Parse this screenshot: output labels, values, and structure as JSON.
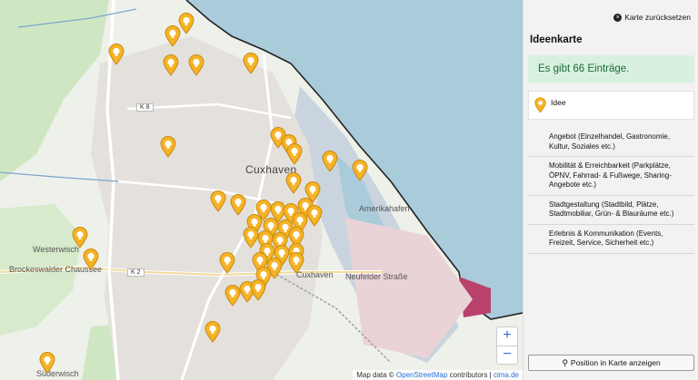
{
  "map": {
    "city_label": "Cuxhaven",
    "street_labels": [
      {
        "text": "Westerwisch"
      },
      {
        "text": "Brockeswalder Chaussee"
      },
      {
        "text": "Süderwisch"
      },
      {
        "text": "Cuxhaven"
      },
      {
        "text": "Neufelder Straße"
      },
      {
        "text": "Amerikahafen"
      }
    ],
    "road_badges": [
      "K 8",
      "K 2"
    ],
    "marker_icon": "lightbulb-pin-icon",
    "marker_color": "#f5b325",
    "zoom_in_label": "+",
    "zoom_out_label": "−",
    "attribution_prefix": "Map data ©",
    "attribution_osm": "OpenStreetMap",
    "attribution_mid": "contributors |",
    "attribution_cima": "cima.de"
  },
  "panel": {
    "reset_label": "Karte zurücksetzen",
    "title": "Ideenkarte",
    "count_text": "Es gibt 66 Einträge.",
    "legend_label": "Idee",
    "categories": [
      "Angebot (Einzelhandel, Gastronomie, Kultur, Soziales etc.)",
      "Mobilität & Erreichbarkeit (Parkplätze, ÖPNV, Fahrrad- & Fußwege, Sharing-Angebote etc.)",
      "Stadtgestaltung (Stadtbild, Plätze, Stadtmobiliar, Grün- & Blauräume etc.)",
      "Erlebnis & Kommunikation (Events, Freizeit, Service, Sicherheit etc.)"
    ],
    "position_button": "Position in Karte anzeigen",
    "accent_green": "#d8f1df"
  }
}
